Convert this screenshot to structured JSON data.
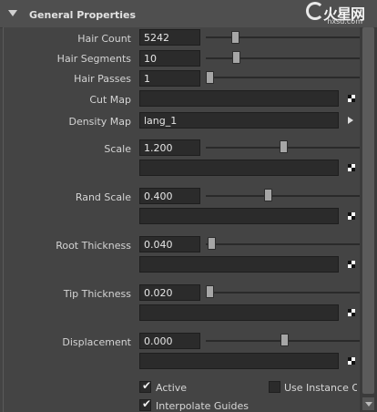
{
  "section": {
    "title": "General Properties"
  },
  "watermark": {
    "brand": "火星网",
    "url": "hxsd.com"
  },
  "params": {
    "hair_count": {
      "label": "Hair Count",
      "value": "5242"
    },
    "hair_segments": {
      "label": "Hair Segments",
      "value": "10"
    },
    "hair_passes": {
      "label": "Hair Passes",
      "value": "1"
    },
    "cut_map": {
      "label": "Cut Map",
      "value": ""
    },
    "density_map": {
      "label": "Density Map",
      "value": "lang_1"
    },
    "scale": {
      "label": "Scale",
      "value": "1.200",
      "map_value": ""
    },
    "rand_scale": {
      "label": "Rand Scale",
      "value": "0.400",
      "map_value": ""
    },
    "root_thickness": {
      "label": "Root Thickness",
      "value": "0.040",
      "map_value": ""
    },
    "tip_thickness": {
      "label": "Tip Thickness",
      "value": "0.020",
      "map_value": ""
    },
    "displacement": {
      "label": "Displacement",
      "value": "0.000",
      "map_value": ""
    }
  },
  "options": {
    "active": {
      "label": "Active",
      "checked": true
    },
    "use_instance": {
      "label": "Use Instance Ob",
      "checked": false
    },
    "interpolate_guides": {
      "label": "Interpolate Guides",
      "checked": true
    }
  },
  "icons": {
    "collapse": "triangle-down-icon",
    "texture_slot": "checker-map-icon",
    "expand": "arrow-right-icon",
    "scroll_down": "scroll-down-arrow-icon"
  }
}
